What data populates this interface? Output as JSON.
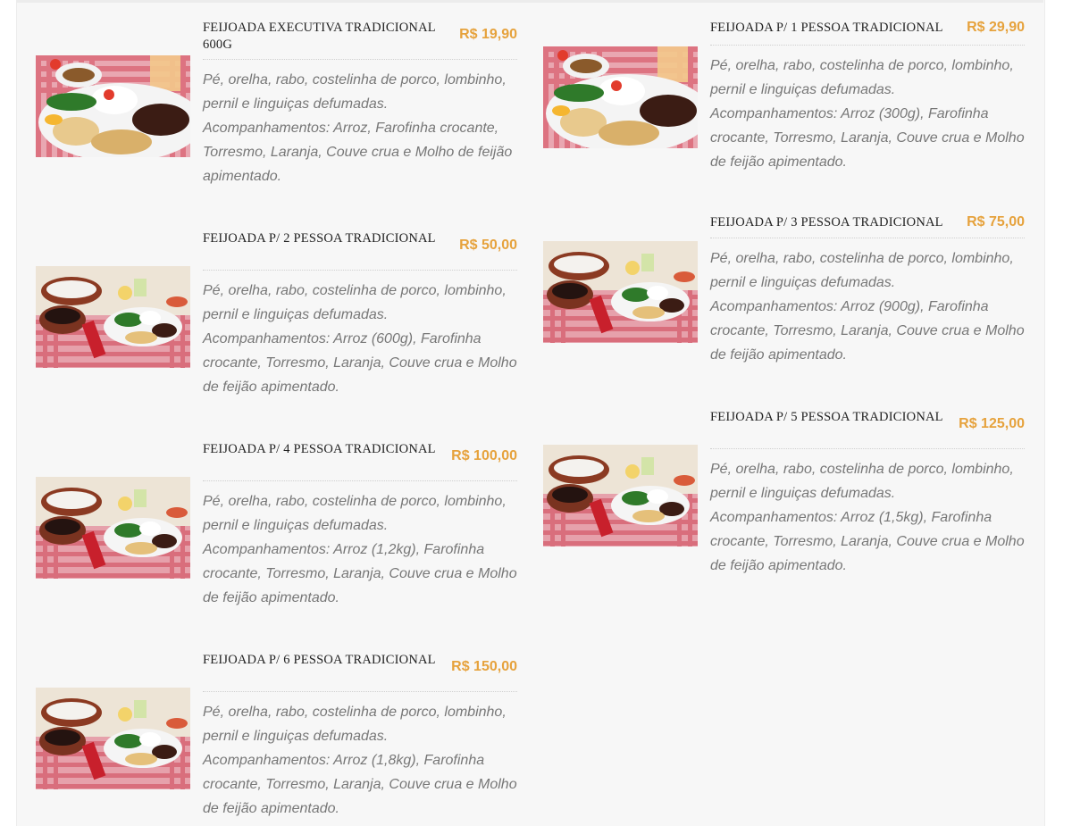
{
  "menu": {
    "left": [
      {
        "name": "FEIJOADA EXECUTIVA TRADICIONAL 600g",
        "price": "R$ 19,90",
        "description": "Pé, orelha, rabo, costelinha de porco, lombinho, pernil e linguiças defumadas. Acompanhamentos: Arroz, Farofinha crocante, Torresmo, Laranja, Couve crua e Molho de feijão apimentado.",
        "photo": "feijoada-executiva-plate"
      },
      {
        "name": "FEIJOADA P/ 2 PESSOA TRADICIONAL",
        "price": "R$ 50,00",
        "description": "Pé, orelha, rabo, costelinha de porco, lombinho, pernil e linguiças defumadas. Acompanhamentos: Arroz (600g), Farofinha crocante, Torresmo, Laranja, Couve crua e Molho de feijão apimentado.",
        "photo": "feijoada-table-spread"
      },
      {
        "name": "FEIJOADA P/ 4 PESSOA TRADICIONAL",
        "price": "R$ 100,00",
        "description": "Pé, orelha, rabo, costelinha de porco, lombinho, pernil e linguiças defumadas. Acompanhamentos: Arroz (1,2kg), Farofinha crocante, Torresmo, Laranja, Couve crua e Molho de feijão apimentado.",
        "photo": "feijoada-table-spread"
      },
      {
        "name": "FEIJOADA P/ 6 PESSOA TRADICIONAL",
        "price": "R$ 150,00",
        "description": "Pé, orelha, rabo, costelinha de porco, lombinho, pernil e linguiças defumadas. Acompanhamentos: Arroz (1,8kg), Farofinha crocante, Torresmo, Laranja, Couve crua e Molho de feijão apimentado.",
        "photo": "feijoada-table-spread"
      }
    ],
    "right": [
      {
        "name": "FEIJOADA P/ 1 PESSOA TRADICIONAL",
        "price": "R$ 29,90",
        "description": "Pé, orelha, rabo, costelinha de porco, lombinho, pernil e linguiças defumadas. Acompanhamentos: Arroz (300g), Farofinha crocante, Torresmo, Laranja, Couve crua e Molho de feijão apimentado.",
        "photo": "feijoada-executiva-plate"
      },
      {
        "name": "FEIJOADA P/ 3 PESSOA TRADICIONAL",
        "price": "R$ 75,00",
        "description": "Pé, orelha, rabo, costelinha de porco, lombinho, pernil e linguiças defumadas. Acompanhamentos: Arroz (900g), Farofinha crocante, Torresmo, Laranja, Couve crua e Molho de feijão apimentado.",
        "photo": "feijoada-table-spread"
      },
      {
        "name": "FEIJOADA P/ 5 PESSOA TRADICIONAL",
        "price": "R$ 125,00",
        "description": "Pé, orelha, rabo, costelinha de porco, lombinho, pernil e linguiças defumadas. Acompanhamentos: Arroz (1,5kg), Farofinha crocante, Torresmo, Laranja, Couve crua e Molho de feijão apimentado.",
        "photo": "feijoada-table-spread"
      }
    ]
  },
  "colors": {
    "price": "#e6a23c",
    "name": "#222222",
    "description": "#777777",
    "panel": "#f7f7f7"
  }
}
